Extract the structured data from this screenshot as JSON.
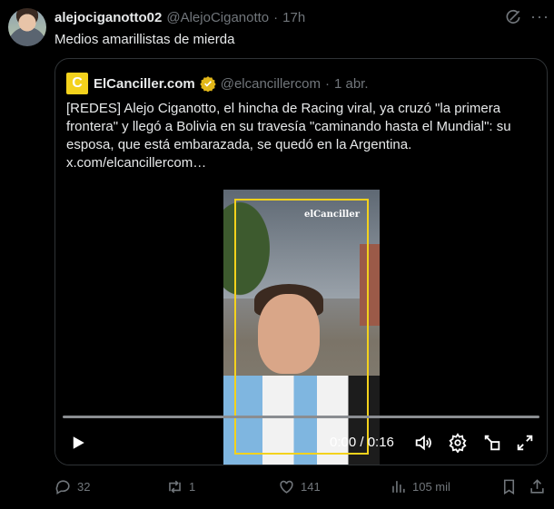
{
  "tweet": {
    "author_name": "alejociganotto02",
    "author_handle": "@AlejoCiganotto",
    "separator": "·",
    "time": "17h",
    "text": "Medios amarillistas de mierda"
  },
  "quote": {
    "logo_letter": "C",
    "author_name": "ElCanciller.com",
    "author_handle": "@elcancillercom",
    "separator": "·",
    "time": "1 abr.",
    "text": "[REDES] Alejo Ciganotto, el hincha de Racing viral, ya cruzó \"la primera frontera\" y llegó a Bolivia en su travesía \"caminando hasta el Mundial\": su esposa, que está embarazada, se quedó en la Argentina.",
    "link": "x.com/elcancillercom…",
    "video": {
      "watermark": "elCanciller",
      "time": "0:00 / 0:16"
    }
  },
  "actions": {
    "replies": "32",
    "reposts": "1",
    "likes": "141",
    "views": "105 mil"
  },
  "colors": {
    "accent_yellow": "#f4d21c",
    "muted": "#71767b",
    "border": "#2f3336"
  }
}
